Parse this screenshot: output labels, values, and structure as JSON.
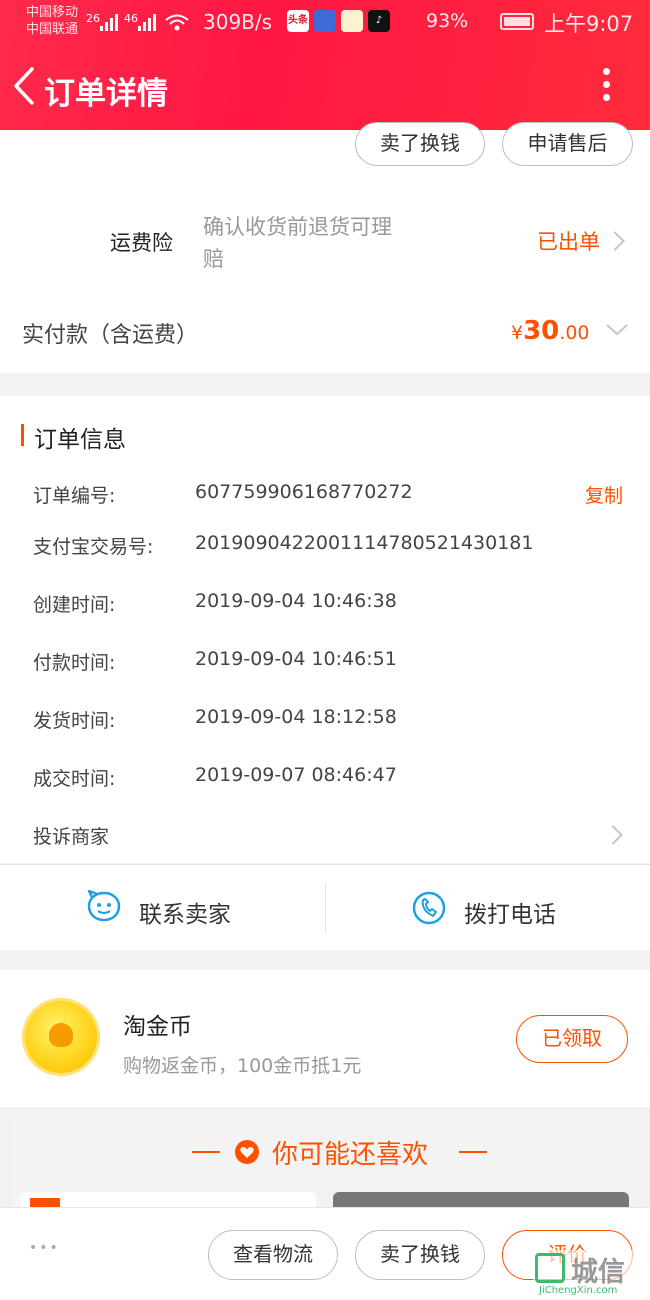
{
  "status_bar": {
    "carrier_1": "中国移动",
    "carrier_2": "中国联通",
    "signal_1": "26",
    "signal_2": "46",
    "net_speed": "309B/s",
    "app_icon_1": "头条",
    "battery": "93%",
    "time": "上午9:07"
  },
  "header": {
    "title": "订单详情"
  },
  "actions_top": {
    "sell_label": "卖了换钱",
    "after_sale_label": "申请售后"
  },
  "insurance": {
    "label": "运费险",
    "desc_line1": "确认收货前退货可理",
    "desc_line2": "赔",
    "status": "已出单"
  },
  "payment": {
    "label": "实付款（含运费）",
    "currency": "¥",
    "amount_int": "30",
    "amount_dec": ".00"
  },
  "order_info": {
    "section_title": "订单信息",
    "copy_label": "复制",
    "rows": [
      {
        "label": "订单编号:",
        "value": "607759906168770272"
      },
      {
        "label": "支付宝交易号:",
        "value": "2019090422001114780521430181"
      },
      {
        "label": "创建时间:",
        "value": "2019-09-04 10:46:38"
      },
      {
        "label": "付款时间:",
        "value": "2019-09-04 10:46:51"
      },
      {
        "label": "发货时间:",
        "value": "2019-09-04 18:12:58"
      },
      {
        "label": "成交时间:",
        "value": "2019-09-07 08:46:47"
      }
    ],
    "complaint_label": "投诉商家"
  },
  "contact": {
    "seller_label": "联系卖家",
    "phone_label": "拨打电话"
  },
  "coins": {
    "title": "淘金币",
    "desc": "购物返金币，100金币抵1元",
    "button_label": "已领取"
  },
  "recommend": {
    "title": "你可能还喜欢"
  },
  "bottom_bar": {
    "more_dots": "•••",
    "logistics_label": "查看物流",
    "sell_label": "卖了换钱",
    "review_label": "评价"
  },
  "watermark": {
    "brand": "城信",
    "url": "JiChengXin.com"
  },
  "colors": {
    "accent": "#ff5000",
    "header": "#ff1f44",
    "icon_blue": "#1ea0e6"
  }
}
